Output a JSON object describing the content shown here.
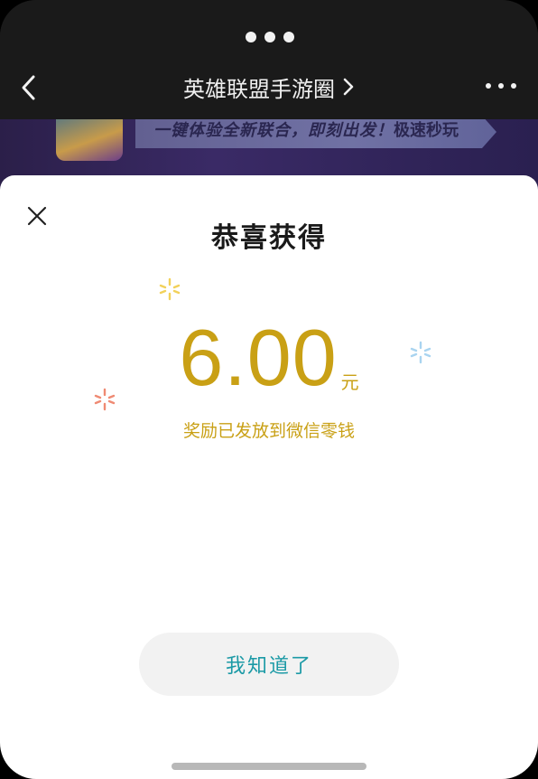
{
  "nav": {
    "title": "英雄联盟手游圈",
    "back_icon": "chevron-left-icon",
    "title_chevron_icon": "chevron-right-icon",
    "more_icon": "more-horizontal-icon",
    "capsule_icon": "three-dots-icon"
  },
  "banner": {
    "text": "一键体验全新联合，即刻出发！",
    "button_text": "极速秒玩"
  },
  "modal": {
    "close_icon": "close-icon",
    "title": "恭喜获得",
    "amount": "6.00",
    "unit": "元",
    "subtext": "奖励已发放到微信零钱",
    "button_label": "我知道了"
  },
  "colors": {
    "accent_gold": "#c9a015",
    "button_text_teal": "#1c9aa6",
    "topbar_bg": "#1a1a1a",
    "sparkle_yellow": "#f2d15a",
    "sparkle_red": "#ef8a73",
    "sparkle_blue": "#a9d4f0"
  }
}
